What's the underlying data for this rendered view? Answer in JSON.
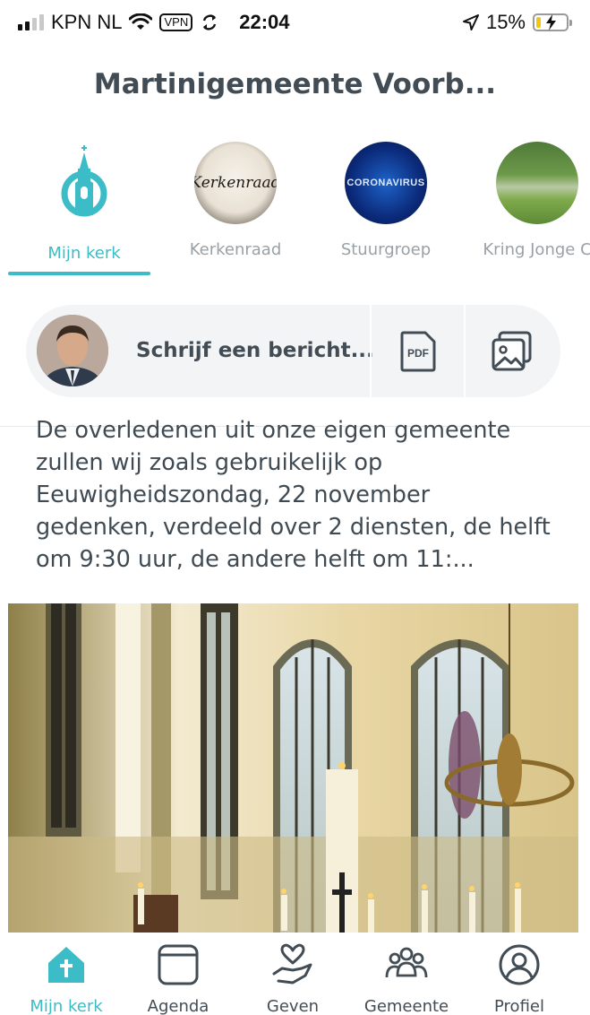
{
  "status_bar": {
    "carrier": "KPN NL",
    "vpn_badge": "VPN",
    "time": "22:04",
    "battery_percent": "15%",
    "battery_level": 0.15,
    "battery_color": "#f2c80f"
  },
  "header": {
    "title": "Martinigemeente Voorb..."
  },
  "channels": [
    {
      "label": "Mijn kerk",
      "icon": "church-logo-icon",
      "active": true
    },
    {
      "label": "Kerkenraad",
      "avatar_text": "Kerkenraad",
      "active": false
    },
    {
      "label": "Stuurgroep",
      "avatar_text": "CORONAVIRUS",
      "active": false
    },
    {
      "label": "Kring Jonge C",
      "active": false
    }
  ],
  "composer": {
    "placeholder": "Schrijf een bericht...",
    "pdf_icon_text": "PDF"
  },
  "post": {
    "text": "De overledenen uit onze eigen gemeente zullen wij zoals gebruikelijk op Eeuwigheidszondag, 22 november gedenken, verdeeld over 2 diensten, de helft om 9:30 uur, de andere helft om 11:..."
  },
  "bottom_nav": [
    {
      "label": "Mijn kerk",
      "icon": "home-church-icon",
      "active": true
    },
    {
      "label": "Agenda",
      "icon": "calendar-icon",
      "active": false
    },
    {
      "label": "Geven",
      "icon": "giving-heart-hand-icon",
      "active": false
    },
    {
      "label": "Gemeente",
      "icon": "people-group-icon",
      "active": false
    },
    {
      "label": "Profiel",
      "icon": "profile-icon",
      "active": false
    }
  ],
  "colors": {
    "accent": "#3bbcc6",
    "text": "#424c55",
    "muted": "#9aa1a6"
  }
}
